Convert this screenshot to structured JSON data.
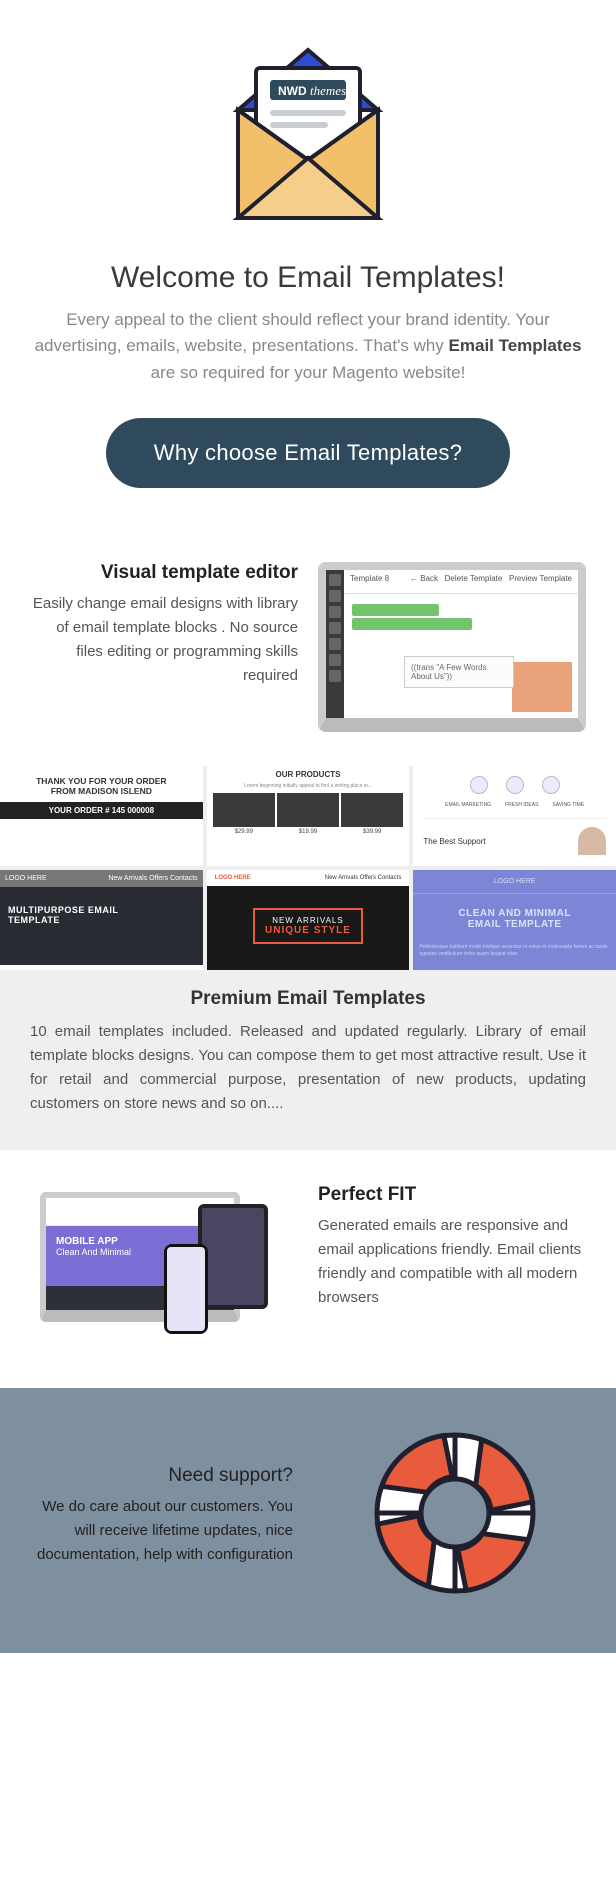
{
  "hero": {
    "logo_left": "NWD",
    "logo_right": "themes",
    "title": "Welcome to Email Templates!",
    "lead_1": "Every appeal to the client should reflect your brand identity. Your advertising, emails, website, presentations. That's why ",
    "lead_bold": "Email Templates",
    "lead_2": " are so required for your Magento website!",
    "cta": "Why choose Email Templates?"
  },
  "feature1": {
    "title": "Visual template editor",
    "body": "Easily change email designs with library of email template blocks . No source files editing or programming skills required",
    "mock": {
      "title": "Template 8",
      "btn_back": "← Back",
      "btn_del": "Delete Template",
      "btn_prev": "Preview Template",
      "note": "((trans \"A Few Words About Us\"))"
    }
  },
  "templates": {
    "t1_line1": "THANK YOU FOR YOUR ORDER",
    "t1_line2": "FROM MADISON ISLEND",
    "t1_order": "YOUR ORDER # 145 000008",
    "t2_head": "OUR PRODUCTS",
    "t2_p1": "$29.99",
    "t2_p2": "$19.99",
    "t2_p3": "$39.99",
    "t3_l1": "EMAIL MARKETING",
    "t3_l2": "FRESH IDEAS",
    "t3_l3": "SAVING TIME",
    "t3_sup": "The Best Support",
    "t4_logo": "LOGO HERE",
    "t4_nav": "New Arrivals   Offers   Contacts",
    "t4_t1": "MULTIPURPOSE EMAIL",
    "t4_t2": "TEMPLATE",
    "t5_logo": "LOGO HERE",
    "t5_nav": "New Arrivals   Offers   Contacts",
    "t5_l1": "NEW ARRIVALS",
    "t5_l2": "UNIQUE STYLE",
    "t6_logo": "LOGO HERE",
    "t6_t1": "CLEAN AND MINIMAL",
    "t6_t2": "EMAIL TEMPLATE"
  },
  "premium": {
    "title": "Premium Email Templates",
    "body": "10 email templates included. Released and updated regularly. Library of email template blocks designs. You can compose them to get most attractive result.  Use it for retail and commercial purpose, presentation of new products, updating customers on store news and so on...."
  },
  "feature2": {
    "title": "Perfect FIT",
    "body": "Generated emails are responsive and email applications friendly. Email clients friendly and compatible with all modern browsers",
    "mock_title": "MOBILE APP",
    "mock_sub": "Clean And Minimal"
  },
  "support": {
    "title": "Need support?",
    "body": "We do care about our customers. You will receive lifetime updates, nice documentation, help with configuration"
  }
}
